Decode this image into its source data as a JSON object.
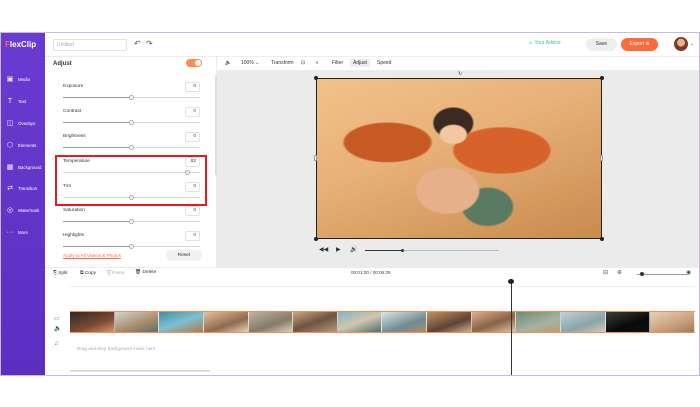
{
  "app": {
    "logo": "FlexClip",
    "doc_title": "Untitled"
  },
  "header": {
    "advice": "Your Advice",
    "save": "Save",
    "export": "Export ⊕"
  },
  "nav": [
    {
      "icon": "media-icon",
      "glyph": "▣",
      "label": "Media"
    },
    {
      "icon": "text-icon",
      "glyph": "T",
      "label": "Text"
    },
    {
      "icon": "overlays-icon",
      "glyph": "◫",
      "label": "Overlays"
    },
    {
      "icon": "elements-icon",
      "glyph": "⬡",
      "label": "Elements"
    },
    {
      "icon": "background-icon",
      "glyph": "▦",
      "label": "Background"
    },
    {
      "icon": "transition-icon",
      "glyph": "⇄",
      "label": "Transition"
    },
    {
      "icon": "watermark-icon",
      "glyph": "◎",
      "label": "Watermark"
    },
    {
      "icon": "more-icon",
      "glyph": "···",
      "label": "More"
    }
  ],
  "panel": {
    "title": "Adjust",
    "rows": [
      {
        "label": "Exposure",
        "value": "0",
        "level": 0.5
      },
      {
        "label": "Contrast",
        "value": "0",
        "level": 0.5
      },
      {
        "label": "Brightness",
        "value": "0",
        "level": 0.5
      },
      {
        "label": "Temperature",
        "value": "82",
        "level": 0.91
      },
      {
        "label": "Tint",
        "value": "0",
        "level": 0.5
      },
      {
        "label": "Saturation",
        "value": "0",
        "level": 0.5
      },
      {
        "label": "Highlights",
        "value": "0",
        "level": 0.5
      }
    ],
    "apply_link": "Apply to All Videos & Photos",
    "reset": "Reset"
  },
  "toolbar": {
    "zoom": "100% ⌄",
    "transform": "Transform",
    "filter": "Filter",
    "adjust": "Adjust",
    "speed": "Speed"
  },
  "player": {
    "progress": 0.27
  },
  "edit_bar": {
    "split": "Split",
    "copy": "Copy",
    "paste": "Paste",
    "delete": "Delete",
    "time": "00:01:00 / 00:06:29"
  },
  "timeline": {
    "music_hint": "Drag and drop background music here"
  }
}
